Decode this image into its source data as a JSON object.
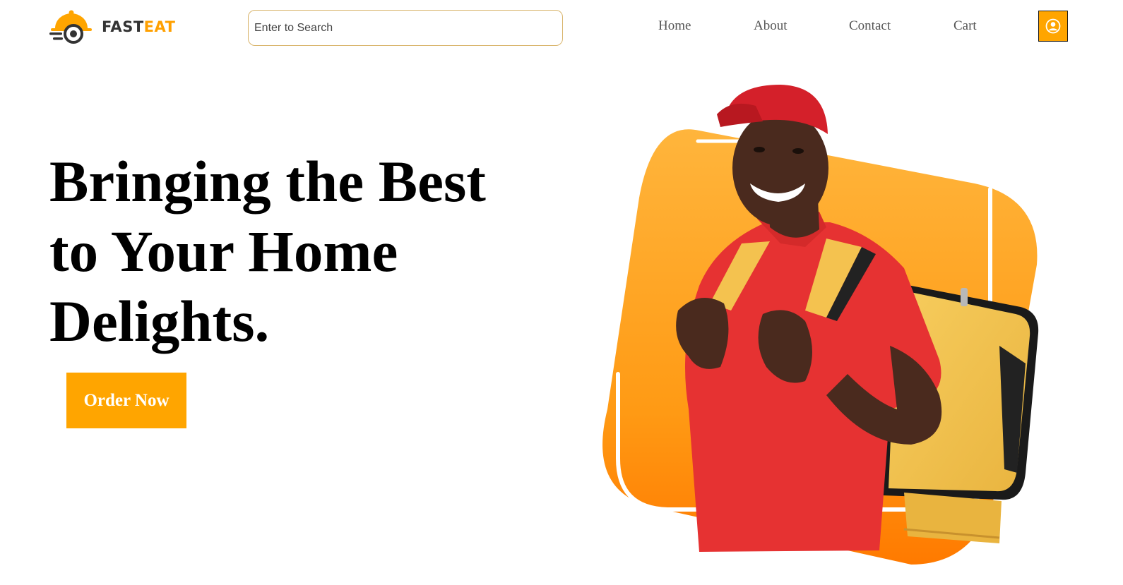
{
  "brand": {
    "name_part1": "FAST",
    "name_part2": "EAT",
    "logo_icon": "food-cloche-delivery-icon"
  },
  "search": {
    "placeholder": "Enter to Search",
    "value": ""
  },
  "nav": {
    "items": [
      "Home",
      "About",
      "Contact",
      "Cart"
    ]
  },
  "profile": {
    "icon": "user-circle-icon"
  },
  "hero": {
    "title": "Bringing the Best to Your Home Delights.",
    "cta_label": "Order Now",
    "image_icon": "delivery-person-illustration"
  },
  "colors": {
    "accent": "#FFA500",
    "accent_deep": "#FF7A00",
    "shirt": "#E63232",
    "bag": "#F4C24F",
    "text": "#000000",
    "nav_text": "#555555"
  }
}
